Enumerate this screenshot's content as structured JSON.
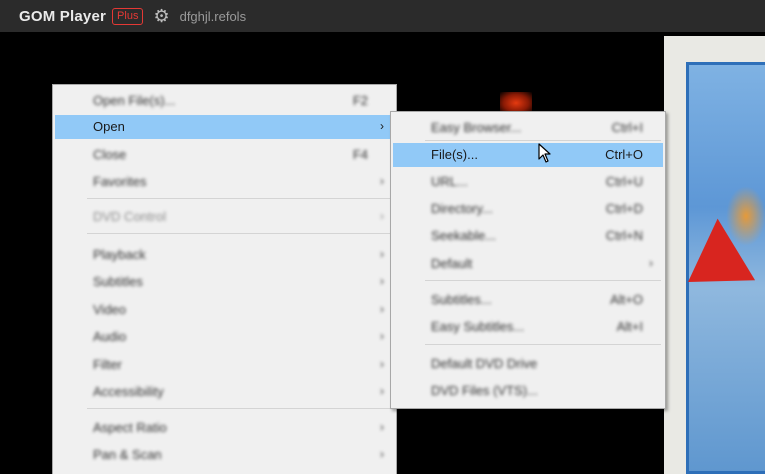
{
  "titlebar": {
    "app_name": "GOM Player",
    "plus_badge": "Plus",
    "settings_icon": "gear-icon",
    "filename": "dfghjl.refols"
  },
  "main_menu": {
    "items": [
      {
        "label": "Open File(s)...",
        "shortcut": "F2",
        "submenu": false,
        "blurred": true
      },
      {
        "label": "Open",
        "shortcut": "",
        "submenu": true,
        "blurred": false
      },
      {
        "label": "Close",
        "shortcut": "F4",
        "submenu": false,
        "blurred": true
      },
      {
        "label": "Favorites",
        "shortcut": "",
        "submenu": true,
        "blurred": true
      },
      {
        "label": "DVD Control",
        "shortcut": "",
        "submenu": true,
        "blurred": true
      },
      {
        "label": "Playback",
        "shortcut": "",
        "submenu": true,
        "blurred": true
      },
      {
        "label": "Subtitles",
        "shortcut": "",
        "submenu": true,
        "blurred": true
      },
      {
        "label": "Video",
        "shortcut": "",
        "submenu": true,
        "blurred": true
      },
      {
        "label": "Audio",
        "shortcut": "",
        "submenu": true,
        "blurred": true
      },
      {
        "label": "Filter",
        "shortcut": "",
        "submenu": true,
        "blurred": true
      },
      {
        "label": "Accessibility",
        "shortcut": "",
        "submenu": true,
        "blurred": true
      },
      {
        "label": "Aspect Ratio",
        "shortcut": "",
        "submenu": true,
        "blurred": true
      },
      {
        "label": "Pan & Scan",
        "shortcut": "",
        "submenu": true,
        "blurred": true
      }
    ]
  },
  "sub_menu": {
    "items": [
      {
        "label": "Easy Browser...",
        "shortcut": "Ctrl+I",
        "blurred": true
      },
      {
        "label": "File(s)...",
        "shortcut": "Ctrl+O",
        "blurred": false
      },
      {
        "label": "URL...",
        "shortcut": "Ctrl+U",
        "blurred": true
      },
      {
        "label": "Directory...",
        "shortcut": "Ctrl+D",
        "blurred": true
      },
      {
        "label": "Seekable...",
        "shortcut": "Ctrl+N",
        "blurred": true
      },
      {
        "label": "Default",
        "shortcut": "",
        "blurred": true
      },
      {
        "label": "Subtitles...",
        "shortcut": "Alt+O",
        "blurred": true
      },
      {
        "label": "Easy Subtitles...",
        "shortcut": "Alt+I",
        "blurred": true
      },
      {
        "label": "Default DVD Drive",
        "shortcut": "",
        "blurred": true
      },
      {
        "label": "DVD Files (VTS)...",
        "shortcut": "",
        "blurred": true
      }
    ]
  },
  "colors": {
    "titlebar_bg": "#2b2b2b",
    "plus_badge": "#e53935",
    "menu_bg": "#f0f0f0",
    "highlight": "#91c9f7"
  }
}
